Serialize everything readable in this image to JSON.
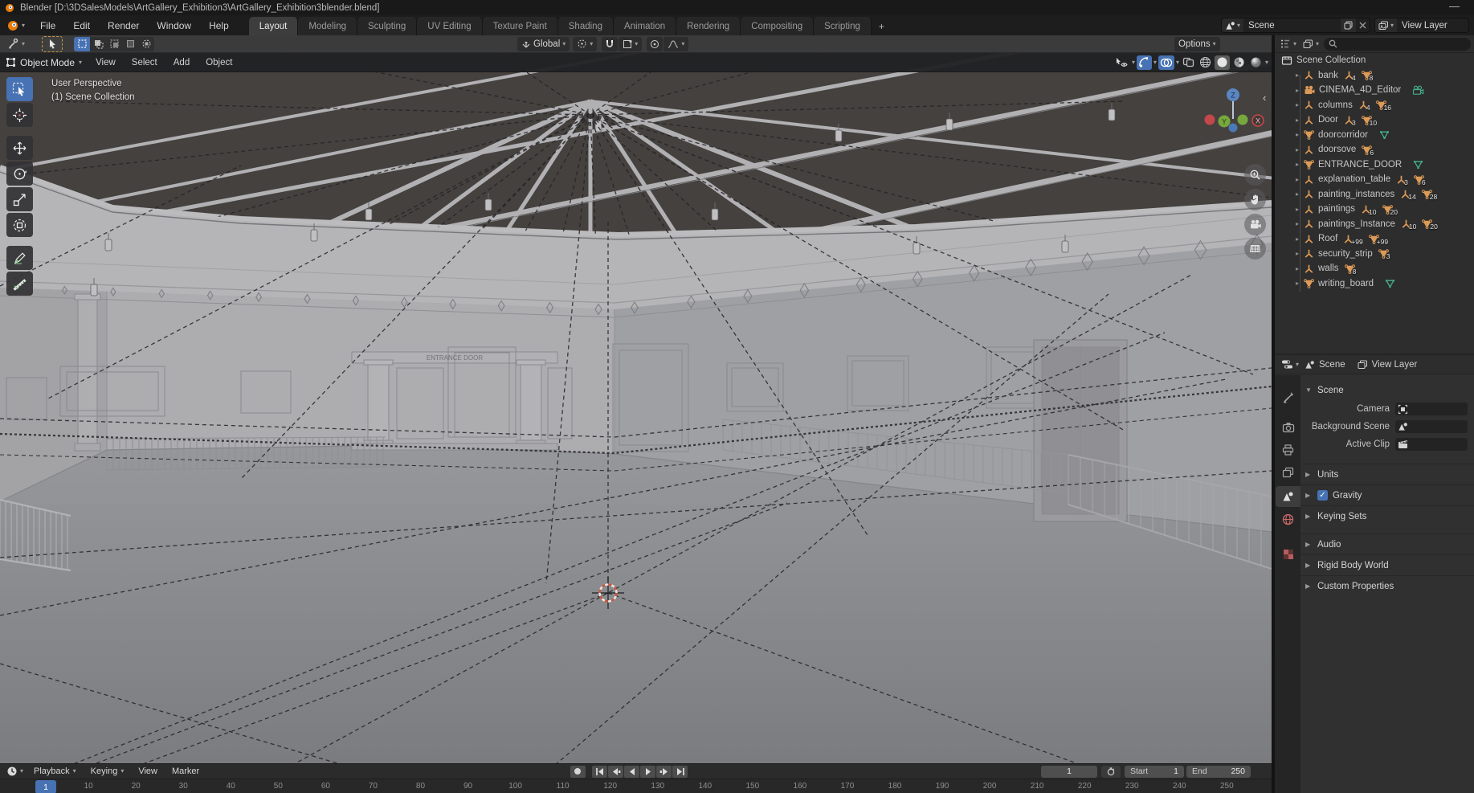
{
  "window": {
    "title": "Blender [D:\\3DSalesModels\\ArtGallery_Exhibition3\\ArtGallery_Exhibition3blender.blend]",
    "minimize": "—"
  },
  "topbar": {
    "menus": [
      "File",
      "Edit",
      "Render",
      "Window",
      "Help"
    ],
    "tabs": [
      "Layout",
      "Modeling",
      "Sculpting",
      "UV Editing",
      "Texture Paint",
      "Shading",
      "Animation",
      "Rendering",
      "Compositing",
      "Scripting"
    ],
    "active_tab": "Layout",
    "new_workspace_label": "+",
    "scene_selector": {
      "value": "Scene"
    },
    "view_layer_selector": {
      "value": "View Layer"
    }
  },
  "tool_settings": {
    "select_modes": [
      "set",
      "extend",
      "subtract",
      "invert",
      "intersect"
    ],
    "active_select_mode": "set",
    "orientation": {
      "value": "Global"
    },
    "options_label": "Options"
  },
  "viewport": {
    "header": {
      "mode": "Object Mode",
      "menus": [
        "View",
        "Select",
        "Add",
        "Object"
      ],
      "shading_modes": [
        "wireframe",
        "solid",
        "material",
        "rendered"
      ],
      "active_shading": "solid"
    },
    "overlay": {
      "line1": "User Perspective",
      "line2": "(1) Scene Collection"
    },
    "entrance_sign": "ENTRANCE DOOR",
    "tools": [
      "select-box",
      "cursor",
      "move",
      "rotate",
      "scale",
      "transform",
      "annotate",
      "measure"
    ],
    "active_tool": "select-box",
    "nav_buttons": [
      "zoom",
      "pan",
      "camera",
      "ortho"
    ],
    "gizmo_axes": {
      "x": "X",
      "y": "Y",
      "z": "Z"
    },
    "collapse_arrow": "‹"
  },
  "outliner": {
    "root_label": "Scene Collection",
    "search_placeholder": "",
    "items": [
      {
        "name": "bank",
        "icon": "empty",
        "badges": [
          {
            "icon": "empty",
            "count": "4"
          },
          {
            "icon": "mesh",
            "count": "8"
          }
        ]
      },
      {
        "name": "CINEMA_4D_Editor",
        "icon": "camera",
        "badges": [],
        "right_icon": "camera-data"
      },
      {
        "name": "columns",
        "icon": "empty",
        "badges": [
          {
            "icon": "empty",
            "count": "4"
          },
          {
            "icon": "mesh",
            "count": "16"
          }
        ]
      },
      {
        "name": "Door",
        "icon": "empty",
        "badges": [
          {
            "icon": "empty",
            "count": "3"
          },
          {
            "icon": "mesh",
            "count": "10"
          }
        ]
      },
      {
        "name": "doorcorridor",
        "icon": "mesh",
        "badges": [],
        "right_icon": "mesh-data"
      },
      {
        "name": "doorsove",
        "icon": "empty",
        "badges": [
          {
            "icon": "mesh",
            "count": "6"
          }
        ]
      },
      {
        "name": "ENTRANCE_DOOR",
        "icon": "mesh",
        "badges": [],
        "right_icon": "mesh-data"
      },
      {
        "name": "explanation_table",
        "icon": "empty",
        "badges": [
          {
            "icon": "empty",
            "count": "3"
          },
          {
            "icon": "mesh",
            "count": "6"
          }
        ]
      },
      {
        "name": "painting_instances",
        "icon": "empty",
        "badges": [
          {
            "icon": "empty",
            "count": "14"
          },
          {
            "icon": "mesh",
            "count": "28"
          }
        ]
      },
      {
        "name": "paintings",
        "icon": "empty",
        "badges": [
          {
            "icon": "empty",
            "count": "10"
          },
          {
            "icon": "mesh",
            "count": "20"
          }
        ]
      },
      {
        "name": "paintings_Instance",
        "icon": "empty",
        "badges": [
          {
            "icon": "empty",
            "count": "10"
          },
          {
            "icon": "mesh",
            "count": "20"
          }
        ]
      },
      {
        "name": "Roof",
        "icon": "empty",
        "badges": [
          {
            "icon": "empty",
            "count": "+99"
          },
          {
            "icon": "mesh",
            "count": "+99"
          }
        ]
      },
      {
        "name": "security_strip",
        "icon": "empty",
        "badges": [
          {
            "icon": "mesh",
            "count": "3"
          }
        ]
      },
      {
        "name": "walls",
        "icon": "empty",
        "badges": [
          {
            "icon": "mesh",
            "count": "8"
          }
        ]
      },
      {
        "name": "writing_board",
        "icon": "mesh",
        "badges": [],
        "right_icon": "mesh-data"
      }
    ]
  },
  "properties": {
    "breadcrumb": {
      "scene": "Scene",
      "view_layer": "View Layer"
    },
    "tabs": [
      "tool",
      "render",
      "output",
      "view-layer",
      "scene",
      "world",
      "texture"
    ],
    "active_tab": "scene",
    "sections": [
      {
        "label": "Scene",
        "state": "expanded",
        "rows": [
          {
            "label": "Camera",
            "icon": "camera-frame"
          },
          {
            "label": "Background Scene",
            "icon": "scene"
          },
          {
            "label": "Active Clip",
            "icon": "clip"
          }
        ]
      },
      {
        "label": "Units",
        "state": "collapsed"
      },
      {
        "label": "Gravity",
        "state": "collapsed",
        "checkbox": true,
        "checked": true
      },
      {
        "label": "Keying Sets",
        "state": "collapsed"
      },
      {
        "label": "Audio",
        "state": "collapsed",
        "gap_before": true
      },
      {
        "label": "Rigid Body World",
        "state": "collapsed"
      },
      {
        "label": "Custom Properties",
        "state": "collapsed"
      }
    ]
  },
  "timeline": {
    "menus": [
      {
        "label": "Playback",
        "chevron": true
      },
      {
        "label": "Keying",
        "chevron": true
      },
      {
        "label": "View"
      },
      {
        "label": "Marker"
      }
    ],
    "auto_key": "record",
    "playback_buttons": [
      "jump-start",
      "prev-keyframe",
      "play-reverse",
      "play",
      "next-keyframe",
      "jump-end"
    ],
    "current_frame": "1",
    "start": {
      "label": "Start",
      "value": "1"
    },
    "end": {
      "label": "End",
      "value": "250"
    },
    "ruler": {
      "current": 1,
      "ticks": [
        10,
        20,
        30,
        40,
        50,
        60,
        70,
        80,
        90,
        100,
        110,
        120,
        130,
        140,
        150,
        160,
        170,
        180,
        190,
        200,
        210,
        220,
        230,
        240,
        250
      ]
    }
  },
  "colors": {
    "accent": "#4772b3",
    "icon_orange": "#dd9a57",
    "icon_green": "#45b08c",
    "cursor_red": "#c24d4d"
  }
}
